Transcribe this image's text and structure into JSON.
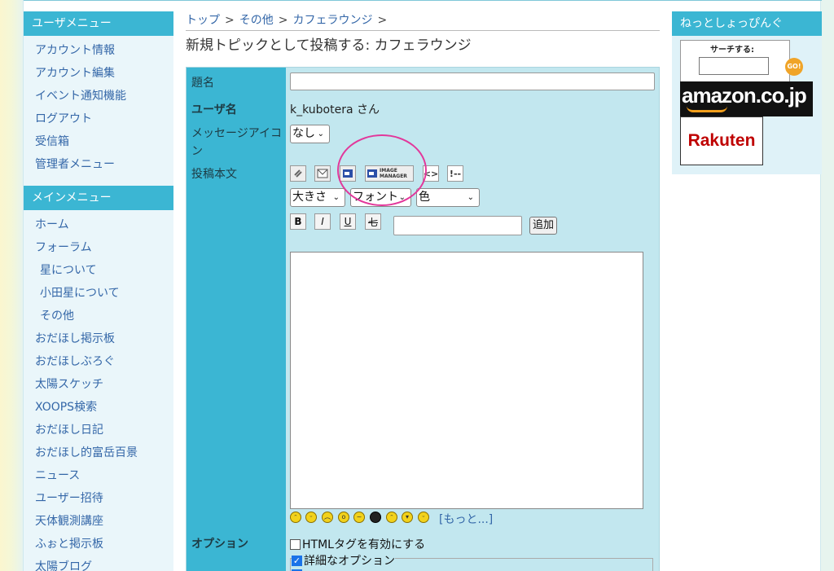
{
  "user_menu": {
    "title": "ユーザメニュー",
    "items": [
      "アカウント情報",
      "アカウント編集",
      "イベント通知機能",
      "ログアウト",
      "受信箱",
      "管理者メニュー"
    ]
  },
  "main_menu": {
    "title": "メインメニュー",
    "items": [
      {
        "label": "ホーム",
        "sub": false
      },
      {
        "label": "フォーラム",
        "sub": false
      },
      {
        "label": "星について",
        "sub": true
      },
      {
        "label": "小田星について",
        "sub": true
      },
      {
        "label": "その他",
        "sub": true
      },
      {
        "label": "おだほし掲示板",
        "sub": false
      },
      {
        "label": "おだほしぶろぐ",
        "sub": false
      },
      {
        "label": "太陽スケッチ",
        "sub": false
      },
      {
        "label": "XOOPS検索",
        "sub": false
      },
      {
        "label": "おだほし日記",
        "sub": false
      },
      {
        "label": "おだほし的富岳百景",
        "sub": false
      },
      {
        "label": "ニュース",
        "sub": false
      },
      {
        "label": "ユーザー招待",
        "sub": false
      },
      {
        "label": "天体観測講座",
        "sub": false
      },
      {
        "label": "ふぉと掲示板",
        "sub": false
      },
      {
        "label": "太陽ブログ",
        "sub": false
      }
    ]
  },
  "breadcrumb": {
    "items": [
      "トップ",
      "その他",
      "カフェラウンジ"
    ],
    "separator": ">"
  },
  "page_title": "新規トピックとして投稿する: カフェラウンジ",
  "form": {
    "subject_label": "題名",
    "subject_value": "",
    "username_label": "ユーザ名",
    "username_value": "k_kubotera さん",
    "icon_label": "メッセージアイコン",
    "icon_select": "なし",
    "body_label": "投稿本文",
    "toolbar": {
      "image_manager_label": "IMAGE MANAGER",
      "code_label": "<>",
      "quote_label": "!--",
      "size_select": "大きさ",
      "font_select": "フォント",
      "color_select": "色",
      "bold": "B",
      "italic": "I",
      "underline": "U",
      "strike": "七",
      "add_button": "追加"
    },
    "body_value": "",
    "more_link": "[もっと...]",
    "options_label": "オプション",
    "option_html": "HTMLタグを有効にする",
    "option_detail": "詳細なオプション"
  },
  "shopping": {
    "title": "ねっとしょっぴんぐ",
    "search_label": "サーチする:",
    "go_label": "GO!",
    "amazon_text": "amazon.co.jp",
    "rakuten_text": "Rakuten"
  },
  "colors": {
    "accent": "#3bb6d3",
    "form_bg": "#c2e7ef",
    "link": "#3467a8",
    "annotation": "#e2389b"
  }
}
